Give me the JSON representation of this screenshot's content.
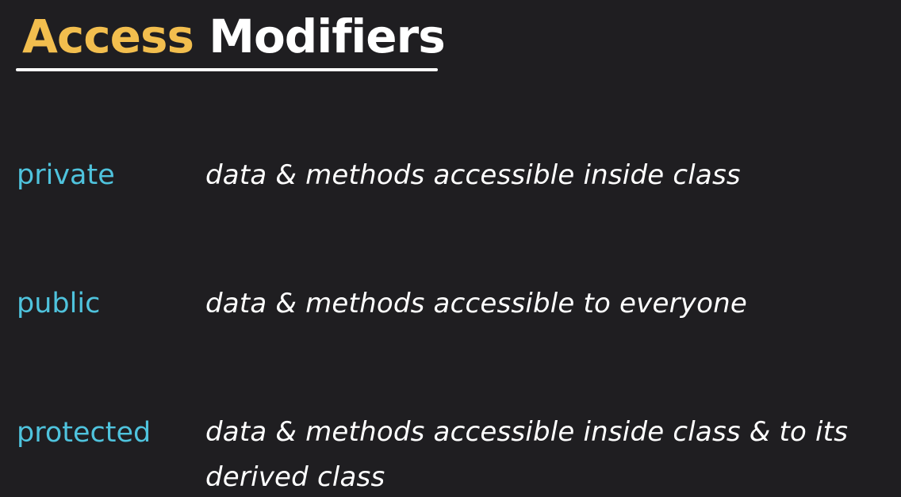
{
  "title": {
    "word1": "Access",
    "word2": "Modifiers"
  },
  "modifiers": [
    {
      "keyword": "private",
      "description": "data & methods accessible inside class"
    },
    {
      "keyword": "public",
      "description": "data & methods accessible to everyone"
    },
    {
      "keyword": "protected",
      "description": "data & methods accessible inside class & to its derived class"
    }
  ],
  "colors": {
    "background": "#1f1e21",
    "title_accent": "#f2be4e",
    "title_main": "#ffffff",
    "keyword": "#4fc3dd",
    "description": "#ffffff"
  }
}
